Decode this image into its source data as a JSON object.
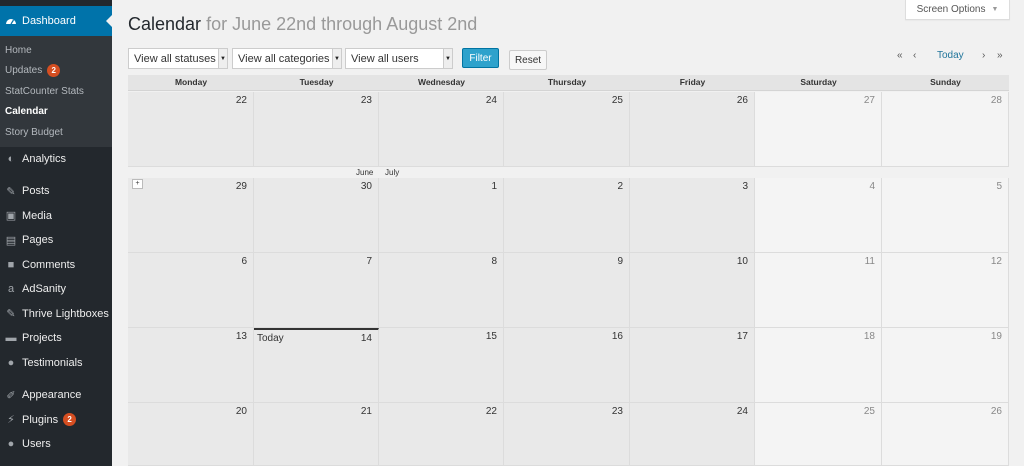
{
  "sidebar": {
    "dashboard": "Dashboard",
    "submenu": [
      {
        "label": "Home",
        "badge": null
      },
      {
        "label": "Updates",
        "badge": "2"
      },
      {
        "label": "StatCounter Stats",
        "badge": null
      },
      {
        "label": "Calendar",
        "badge": null
      },
      {
        "label": "Story Budget",
        "badge": null
      }
    ],
    "items": [
      {
        "label": "Analytics",
        "icon": "chart-icon"
      },
      {
        "label": "Posts",
        "icon": "pin-icon"
      },
      {
        "label": "Media",
        "icon": "media-icon"
      },
      {
        "label": "Pages",
        "icon": "pages-icon"
      },
      {
        "label": "Comments",
        "icon": "comment-icon"
      },
      {
        "label": "AdSanity",
        "icon": "adsanity-icon"
      },
      {
        "label": "Thrive Lightboxes",
        "icon": "pin-icon"
      },
      {
        "label": "Projects",
        "icon": "folder-icon"
      },
      {
        "label": "Testimonials",
        "icon": "testimonial-icon"
      },
      {
        "label": "Appearance",
        "icon": "brush-icon"
      },
      {
        "label": "Plugins",
        "icon": "plug-icon",
        "badge": "2"
      },
      {
        "label": "Users",
        "icon": "user-icon"
      }
    ]
  },
  "header": {
    "title": "Calendar",
    "subtitle": "for June 22nd through August 2nd",
    "screen_options": "Screen Options"
  },
  "filters": {
    "statuses": "View all statuses",
    "categories": "View all categories",
    "users": "View all users",
    "filter_button": "Filter",
    "reset_button": "Reset"
  },
  "nav": {
    "first": "«",
    "prev": "‹",
    "today": "Today",
    "next": "›",
    "last": "»"
  },
  "calendar": {
    "day_names": [
      "Monday",
      "Tuesday",
      "Wednesday",
      "Thursday",
      "Friday",
      "Saturday",
      "Sunday"
    ],
    "weeks": [
      [
        "22",
        "23",
        "24",
        "25",
        "26",
        "27",
        "28"
      ],
      [
        "29",
        "30",
        "1",
        "2",
        "3",
        "4",
        "5"
      ],
      [
        "6",
        "7",
        "8",
        "9",
        "10",
        "11",
        "12"
      ],
      [
        "13",
        "14",
        "15",
        "16",
        "17",
        "18",
        "19"
      ],
      [
        "20",
        "21",
        "22",
        "23",
        "24",
        "25",
        "26"
      ]
    ],
    "month_labels": [
      "June",
      "July"
    ],
    "today_label": "Today",
    "expand": "+"
  }
}
